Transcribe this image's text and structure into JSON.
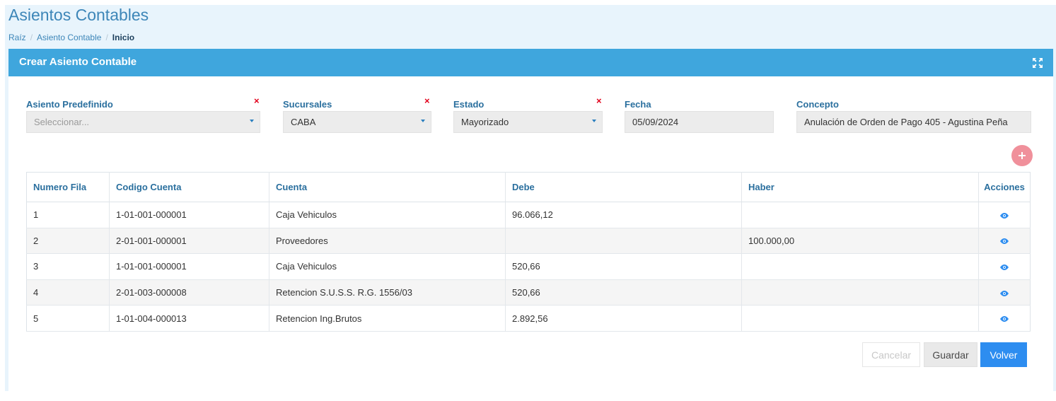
{
  "page": {
    "title": "Asientos Contables",
    "breadcrumb": [
      "Raíz",
      "Asiento Contable",
      "Inicio"
    ],
    "separator": "/"
  },
  "card": {
    "title": "Crear Asiento Contable",
    "expand_icon": "expand-icon"
  },
  "form": {
    "asiento_predefinido": {
      "label": "Asiento Predefinido",
      "placeholder": "Seleccionar...",
      "value": ""
    },
    "sucursales": {
      "label": "Sucursales",
      "value": "CABA"
    },
    "estado": {
      "label": "Estado",
      "value": "Mayorizado"
    },
    "fecha": {
      "label": "Fecha",
      "value": "05/09/2024"
    },
    "concepto": {
      "label": "Concepto",
      "value": "Anulación de Orden de Pago 405 - Agustina Peña"
    },
    "clear_icon": "×"
  },
  "table": {
    "headers": [
      "Numero Fila",
      "Codigo Cuenta",
      "Cuenta",
      "Debe",
      "Haber",
      "Acciones"
    ],
    "rows": [
      {
        "numero": "1",
        "codigo": "1-01-001-000001",
        "cuenta": "Caja Vehiculos",
        "debe": "96.066,12",
        "haber": ""
      },
      {
        "numero": "2",
        "codigo": "2-01-001-000001",
        "cuenta": "Proveedores",
        "debe": "",
        "haber": "100.000,00"
      },
      {
        "numero": "3",
        "codigo": "1-01-001-000001",
        "cuenta": "Caja Vehiculos",
        "debe": "520,66",
        "haber": ""
      },
      {
        "numero": "4",
        "codigo": "2-01-003-000008",
        "cuenta": "Retencion S.U.S.S. R.G. 1556/03",
        "debe": "520,66",
        "haber": ""
      },
      {
        "numero": "5",
        "codigo": "1-01-004-000013",
        "cuenta": "Retencion Ing.Brutos",
        "debe": "2.892,56",
        "haber": ""
      }
    ],
    "row_action_icon": "eye-icon"
  },
  "actions": {
    "cancel": "Cancelar",
    "save": "Guardar",
    "back": "Volver"
  },
  "colors": {
    "header": "#3fa6dd",
    "accent": "#2d8df0",
    "add_button": "#f0909b",
    "clear": "#e2001a"
  }
}
